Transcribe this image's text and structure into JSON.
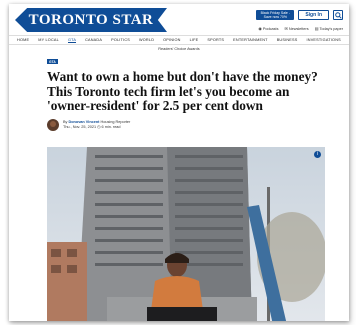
{
  "header": {
    "logo_text": "TORONTO STAR",
    "promo_label": "Black Friday Sale - Save now 70%",
    "signin_label": "Sign In",
    "util_links": [
      {
        "icon": "podcast-icon",
        "label": "Podcasts"
      },
      {
        "icon": "newsletter-icon",
        "label": "Newsletters"
      },
      {
        "icon": "paper-icon",
        "label": "Today's paper"
      }
    ]
  },
  "nav": {
    "items": [
      "HOME",
      "MY LOCAL",
      "GTA",
      "CANADA",
      "POLITICS",
      "WORLD",
      "OPINION",
      "LIFE",
      "SPORTS",
      "ENTERTAINMENT",
      "BUSINESS",
      "INVESTIGATIONS"
    ],
    "active": "GTA"
  },
  "awards_text": "Readers' Choice Awards",
  "article": {
    "tag": "GTA",
    "headline": "Want to own a home but don't have the money? This Toronto tech firm let's you become an 'owner-resident' for 2.5 per cent down",
    "byline_prefix": "By",
    "author": "Donovan Vincent",
    "author_role": "Housing Reporter",
    "date_line": "Thu., Nov. 25, 2021",
    "read_time": "6 min. read"
  },
  "colors": {
    "brand": "#0f4d97"
  }
}
